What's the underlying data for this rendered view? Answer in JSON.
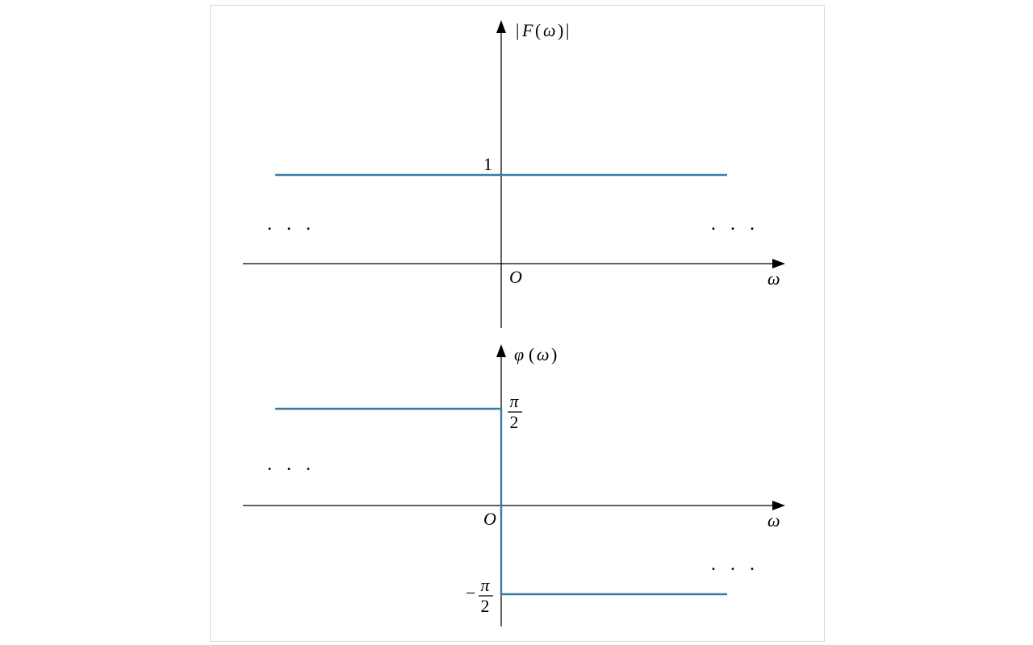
{
  "chart_data": [
    {
      "type": "line",
      "title": "|F(ω)|",
      "xlabel": "ω",
      "ylabel": "|F(ω)|",
      "origin_label": "O",
      "series": [
        {
          "name": "|F(ω)|",
          "description": "constant 1 for all ω",
          "value": 1
        }
      ],
      "y_tick_labels": [
        "1"
      ],
      "continuation_left": "...",
      "continuation_right": "..."
    },
    {
      "type": "line",
      "title": "φ(ω)",
      "xlabel": "ω",
      "ylabel": "φ(ω)",
      "origin_label": "O",
      "series": [
        {
          "name": "φ(ω)",
          "description": "π/2 for ω<0, -π/2 for ω>0 (odd step)",
          "value_negative_omega": "π/2",
          "value_positive_omega": "-π/2"
        }
      ],
      "y_tick_labels": [
        "π/2",
        "-π/2"
      ],
      "continuation_left": "...",
      "continuation_right": "..."
    }
  ],
  "labels": {
    "top_ylabel_abs_left": "|",
    "top_ylabel_F": "F",
    "top_ylabel_paren_open": "(",
    "top_ylabel_omega": "ω",
    "top_ylabel_paren_close": ")",
    "top_ylabel_abs_right": "|",
    "top_tick_1": "1",
    "top_origin": "O",
    "top_xlabel": "ω",
    "dots": ". . .",
    "bot_ylabel_phi": "φ",
    "bot_ylabel_paren_open": "(",
    "bot_ylabel_omega": "ω",
    "bot_ylabel_paren_close": ")",
    "bot_origin": "O",
    "bot_xlabel": "ω",
    "frac_pi": "π",
    "frac_2": "2",
    "minus": "−"
  }
}
